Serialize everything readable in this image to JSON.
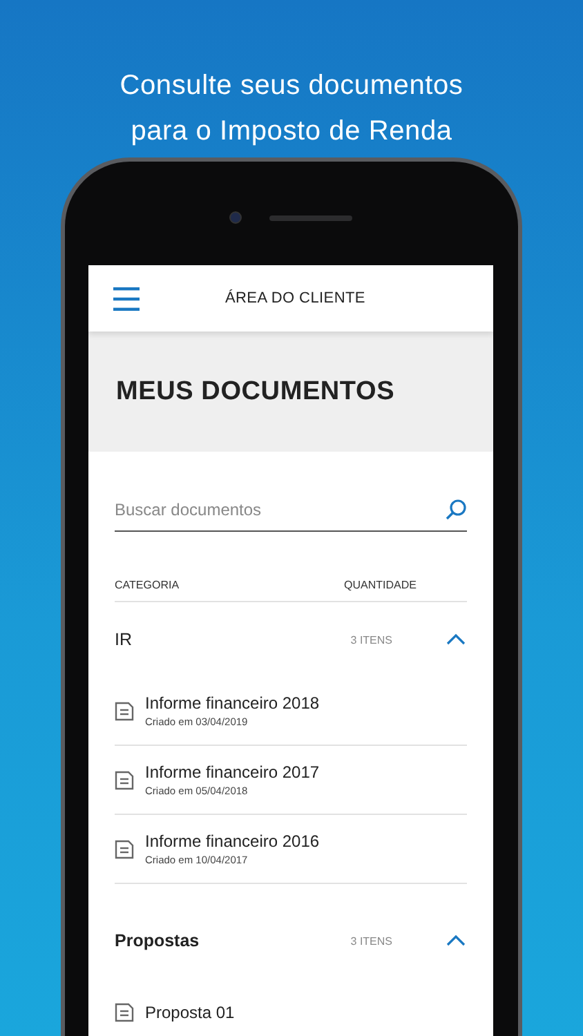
{
  "headline": [
    "Consulte seus documentos",
    "para o Imposto de Renda"
  ],
  "app_bar": {
    "title": "ÁREA DO CLIENTE"
  },
  "page_title": "MEUS DOCUMENTOS",
  "search": {
    "placeholder": "Buscar documentos"
  },
  "columns": [
    "CATEGORIA",
    "QUANTIDADE"
  ],
  "groups": [
    {
      "name": "IR",
      "count": "3 ITENS",
      "expanded": true,
      "items": [
        {
          "title": "Informe financeiro 2018",
          "date": "Criado em 03/04/2019"
        },
        {
          "title": "Informe financeiro 2017",
          "date": "Criado em 05/04/2018"
        },
        {
          "title": "Informe financeiro 2016",
          "date": "Criado em 10/04/2017"
        }
      ]
    },
    {
      "name": "Propostas",
      "count": "3 ITENS",
      "expanded": true,
      "items": [
        {
          "title": "Proposta 01"
        }
      ]
    }
  ]
}
